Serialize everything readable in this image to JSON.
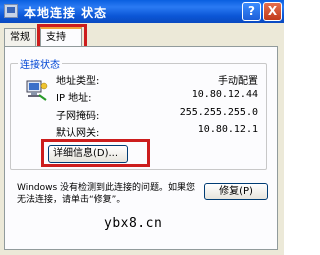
{
  "window": {
    "title": "本地连接 状态",
    "help_glyph": "?",
    "close_glyph": "X"
  },
  "tabs": [
    {
      "label": "常规"
    },
    {
      "label": "支持"
    }
  ],
  "connection_status": {
    "group_label": "连接状态",
    "rows": [
      {
        "label": "地址类型:",
        "value": "手动配置"
      },
      {
        "label": "IP 地址:",
        "value": "10.80.12.44"
      },
      {
        "label": "子网掩码:",
        "value": "255.255.255.0"
      },
      {
        "label": "默认网关:",
        "value": "10.80.12.1"
      }
    ],
    "details_button": "详细信息(D)..."
  },
  "message": "Windows 没有检测到此连接的问题。如果您无法连接，请单击“修复”。",
  "repair_button": "修复(P)",
  "watermark": "ybx8.cn",
  "colors": {
    "titlebar": "#0a5fe0",
    "highlight": "#cc1d1d",
    "group_label": "#0046d5"
  }
}
